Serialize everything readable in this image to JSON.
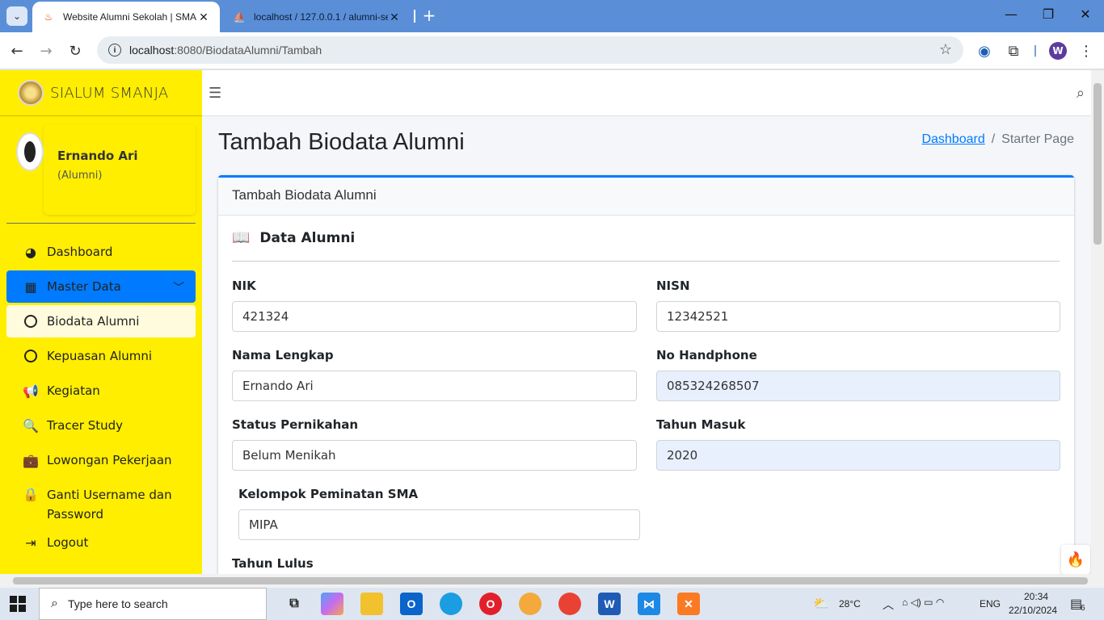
{
  "browser": {
    "tabs": [
      {
        "title": "Website Alumni Sekolah | SMAN",
        "active": true
      },
      {
        "title": "localhost / 127.0.0.1 / alumni-se",
        "active": false
      }
    ],
    "url_host": "localhost",
    "url_rest": ":8080/BiodataAlumni/Tambah",
    "profile_initial": "W"
  },
  "sidebar": {
    "brand": "SIALUM SMANJA",
    "user_name": "Ernando Ari",
    "user_role": "(Alumni)",
    "items": [
      {
        "label": "Dashboard",
        "icon": "tachometer-icon"
      },
      {
        "label": "Master Data",
        "icon": "table-icon"
      },
      {
        "label": "Biodata Alumni",
        "icon": "circle-icon"
      },
      {
        "label": "Kepuasan Alumni",
        "icon": "circle-icon"
      },
      {
        "label": "Kegiatan",
        "icon": "bullhorn-icon"
      },
      {
        "label": "Tracer Study",
        "icon": "search-plus-icon"
      },
      {
        "label": "Lowongan Pekerjaan",
        "icon": "briefcase-icon"
      },
      {
        "label": "Ganti Username dan Password",
        "icon": "lock-icon"
      },
      {
        "label": "Logout",
        "icon": "sign-out-icon"
      }
    ]
  },
  "page": {
    "title": "Tambah Biodata Alumni",
    "breadcrumb_link": "Dashboard",
    "breadcrumb_current": "Starter Page",
    "card_title": "Tambah Biodata Alumni",
    "section_title": "Data Alumni"
  },
  "form": {
    "nik_label": "NIK",
    "nik_value": "421324",
    "nisn_label": "NISN",
    "nisn_value": "12342521",
    "nama_label": "Nama Lengkap",
    "nama_value": "Ernando Ari",
    "hp_label": "No Handphone",
    "hp_value": "085324268507",
    "status_label": "Status Pernikahan",
    "status_value": "Belum Menikah",
    "masuk_label": "Tahun Masuk",
    "masuk_value": "2020",
    "peminatan_label": "Kelompok Peminatan SMA",
    "peminatan_value": "MIPA",
    "lulus_label": "Tahun Lulus"
  },
  "taskbar": {
    "search_placeholder": "Type here to search",
    "weather": "28°C",
    "language": "ENG",
    "time": "20:34",
    "date": "22/10/2024",
    "notifications": "6"
  },
  "colors": {
    "sidebar": "#ffee00",
    "accent": "#007bff",
    "tabbar": "#5a8fd8"
  }
}
